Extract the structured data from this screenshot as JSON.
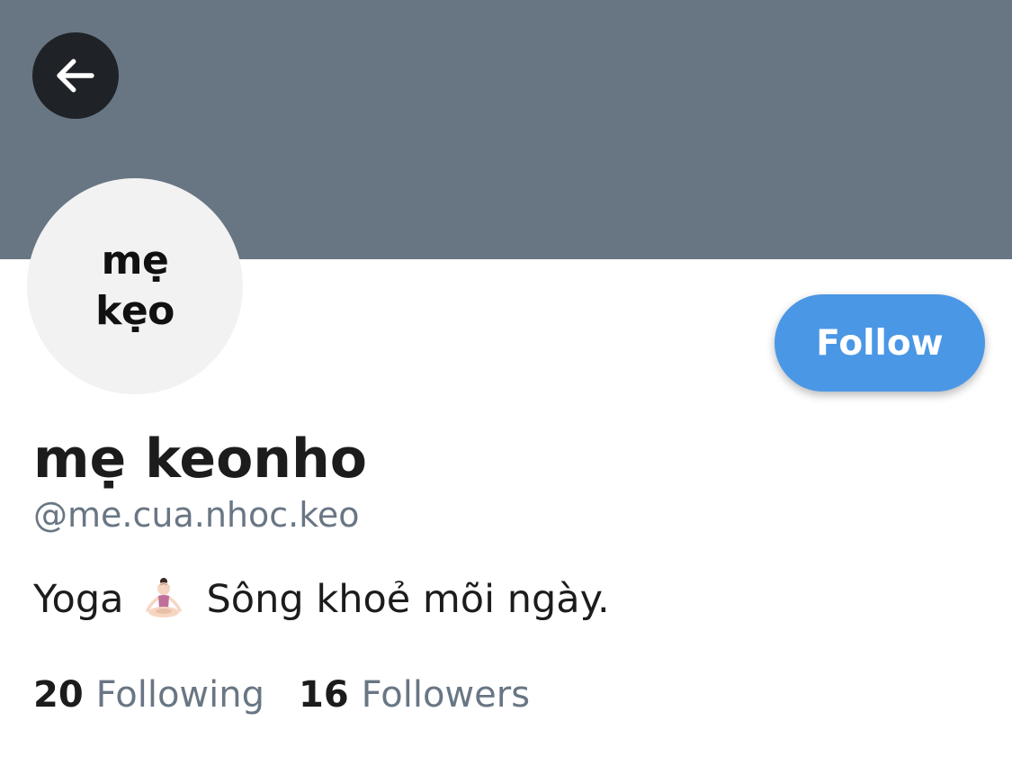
{
  "header": {
    "back_icon": "arrow-left-icon",
    "banner_color": "#687684"
  },
  "avatar": {
    "line1": "mẹ",
    "line2": "kẹo",
    "background": "#f2f2f2"
  },
  "actions": {
    "follow_label": "Follow",
    "follow_color": "#4a97e6"
  },
  "profile": {
    "display_name": "mẹ keonho",
    "handle": "@me.cua.nhoc.keo",
    "bio_before": "Yoga",
    "bio_icon": "yoga-person-icon",
    "bio_after": "Sông khoẻ mõi ngày."
  },
  "stats": {
    "following_count": "20",
    "following_label": "Following",
    "followers_count": "16",
    "followers_label": "Followers"
  }
}
